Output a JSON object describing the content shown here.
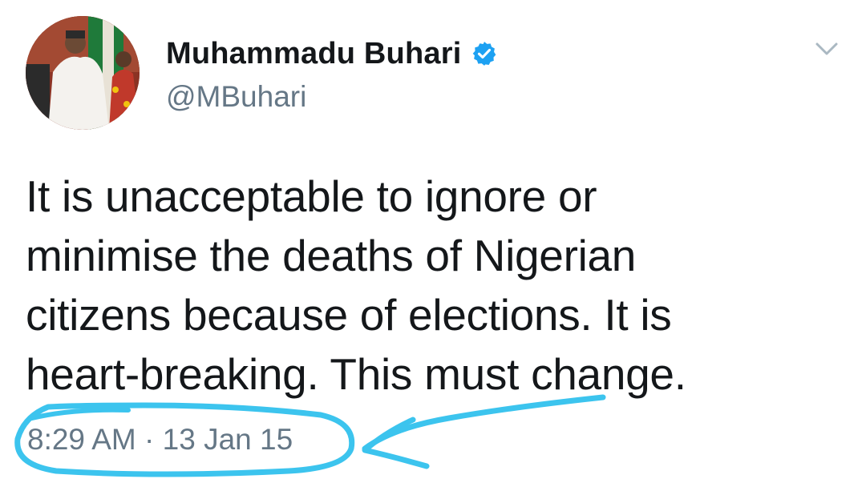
{
  "user": {
    "display_name": "Muhammadu Buhari",
    "handle": "@MBuhari",
    "verified": true
  },
  "tweet": {
    "lines": [
      "It is unacceptable to ignore or",
      "minimise the deaths of Nigerian",
      "citizens because of elections. It is",
      "heart-breaking. This must change."
    ],
    "time": "8:29 AM",
    "separator": "·",
    "date": "13 Jan 15"
  },
  "icons": {
    "verified": "verified-badge-icon",
    "menu": "chevron-down-icon"
  },
  "colors": {
    "text": "#14171a",
    "secondary": "#657786",
    "verified_badge": "#1da1f2",
    "annotation_marker": "#3cc4ee"
  }
}
